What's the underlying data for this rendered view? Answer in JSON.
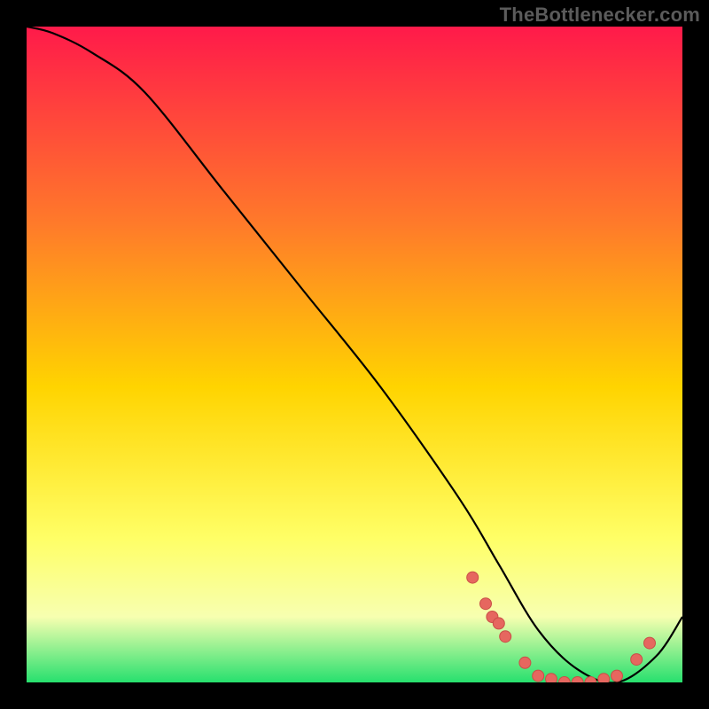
{
  "watermark": "TheBottlenecker.com",
  "colors": {
    "bg_black": "#000000",
    "grad_top": "#ff1a4a",
    "grad_mid_up": "#ff7a2a",
    "grad_mid": "#ffd400",
    "grad_mid_low": "#ffff66",
    "grad_pale": "#f7ffb0",
    "grad_green": "#27e06e",
    "curve": "#000000",
    "dot_fill": "#e6675f",
    "dot_stroke": "#c94f47"
  },
  "chart_data": {
    "type": "line",
    "title": "",
    "xlabel": "",
    "ylabel": "",
    "xlim": [
      0,
      100
    ],
    "ylim": [
      0,
      100
    ],
    "grid": false,
    "legend": false,
    "series": [
      {
        "name": "bottleneck-curve",
        "x": [
          0,
          4,
          10,
          18,
          30,
          42,
          54,
          66,
          72,
          78,
          84,
          90,
          96,
          100
        ],
        "y": [
          100,
          99,
          96,
          90,
          75,
          60,
          45,
          28,
          18,
          8,
          2,
          0,
          4,
          10
        ]
      }
    ],
    "dots": {
      "name": "highlight-dots",
      "points": [
        {
          "x": 68,
          "y": 16
        },
        {
          "x": 70,
          "y": 12
        },
        {
          "x": 71,
          "y": 10
        },
        {
          "x": 72,
          "y": 9
        },
        {
          "x": 73,
          "y": 7
        },
        {
          "x": 76,
          "y": 3
        },
        {
          "x": 78,
          "y": 1
        },
        {
          "x": 80,
          "y": 0.5
        },
        {
          "x": 82,
          "y": 0
        },
        {
          "x": 84,
          "y": 0
        },
        {
          "x": 86,
          "y": 0
        },
        {
          "x": 88,
          "y": 0.5
        },
        {
          "x": 90,
          "y": 1
        },
        {
          "x": 93,
          "y": 3.5
        },
        {
          "x": 95,
          "y": 6
        }
      ]
    }
  }
}
